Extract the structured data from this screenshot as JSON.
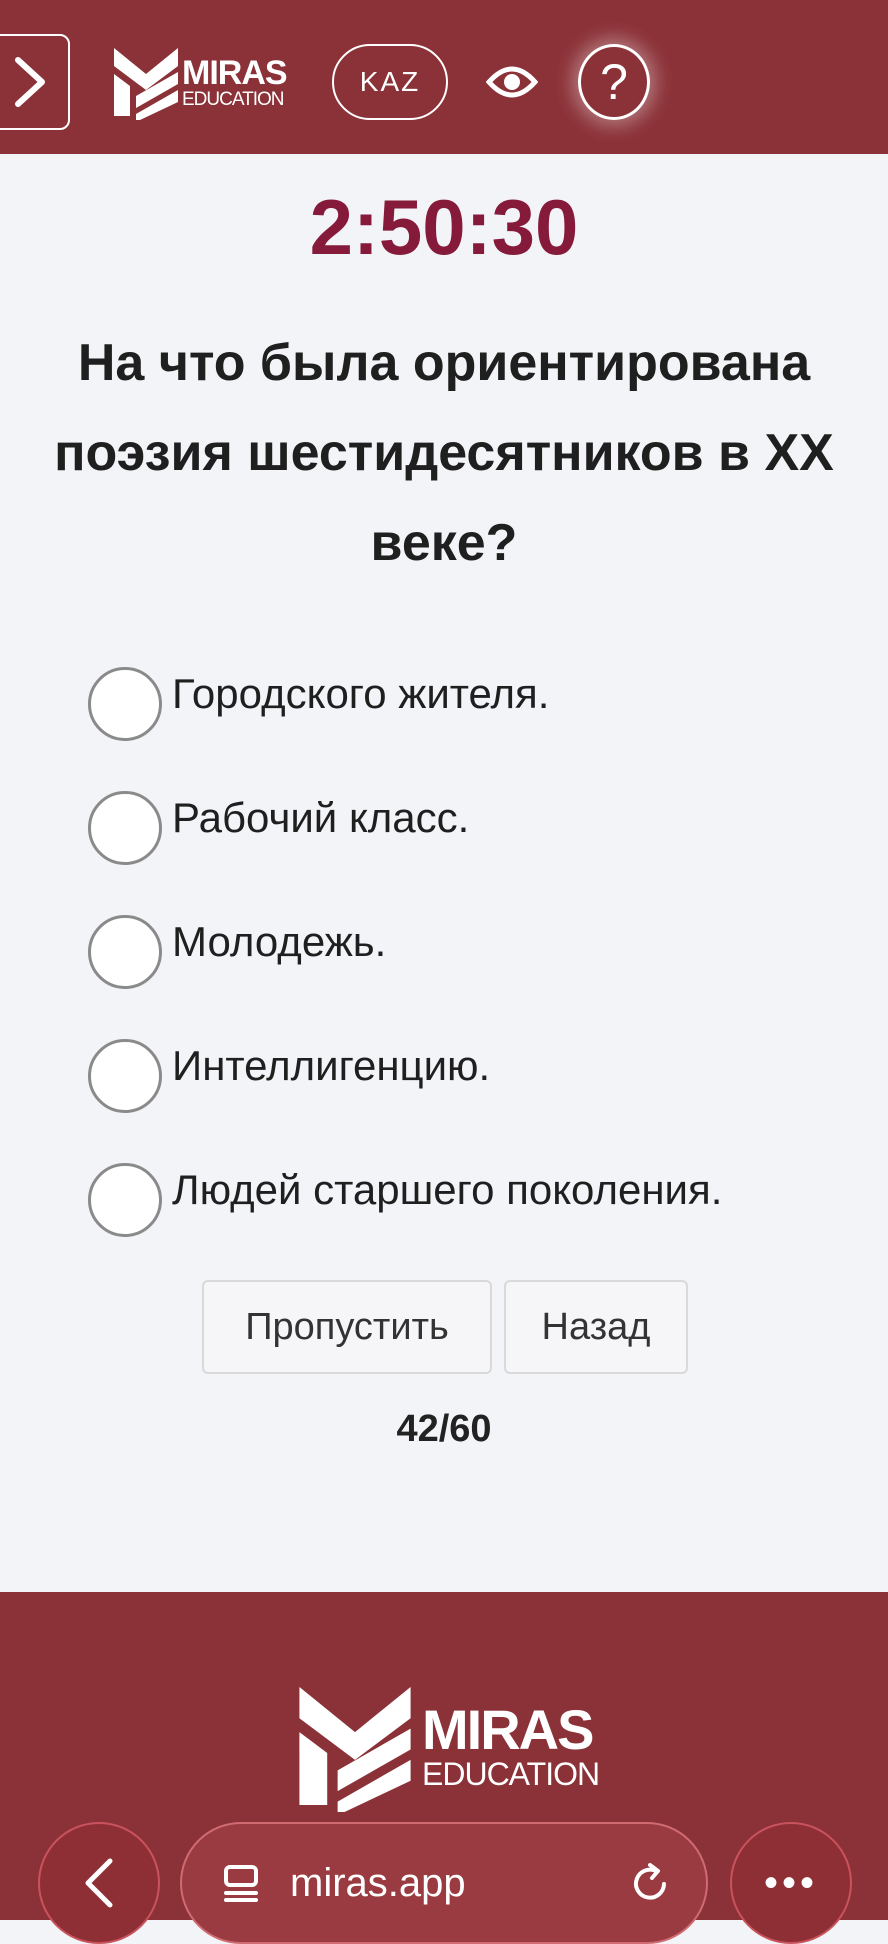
{
  "header": {
    "logo": {
      "line1": "MIRAS",
      "line2": "EDUCATION"
    },
    "language_button": "KAZ",
    "help_button": "?"
  },
  "timer": "2:50:30",
  "question": {
    "line1": "На что была ориентирована",
    "line2": "поэзия шестидесятников в XX",
    "line3": "веке?"
  },
  "options": [
    "Городского жителя.",
    "Рабочий класс.",
    "Молодежь.",
    "Интеллигенцию.",
    "Людей старшего поколения."
  ],
  "buttons": {
    "skip": "Пропустить",
    "back": "Назад"
  },
  "progress": "42/60",
  "footer": {
    "logo": {
      "line1": "MIRAS",
      "line2": "EDUCATION"
    }
  },
  "browser": {
    "url": "miras.app",
    "more": "•••"
  },
  "colors": {
    "brand": "#8b3238",
    "timer": "#861a3a",
    "background": "#f3f4f8"
  }
}
